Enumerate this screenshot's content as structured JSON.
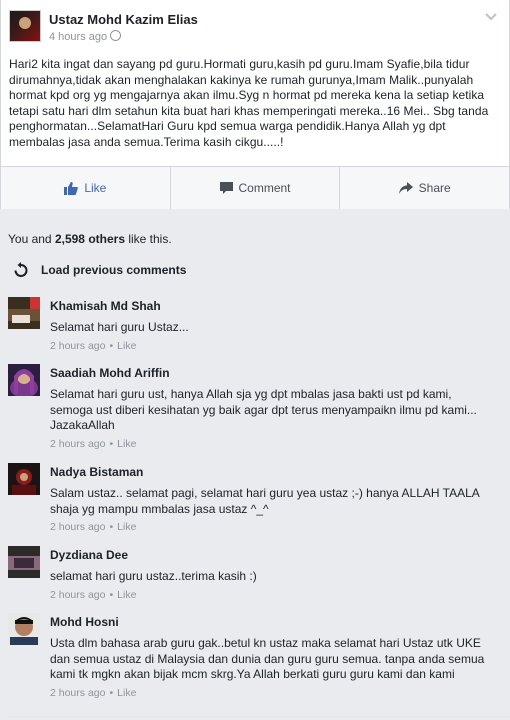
{
  "post": {
    "author": "Ustaz Mohd Kazim Elias",
    "time": "4 hours ago",
    "text": "Hari2 kita ingat dan sayang pd guru.Hormati guru,kasih pd guru.Imam Syafie,bila tidur dirumahnya,tidak akan menghalakan kakinya ke rumah gurunya,Imam Malik..punyalah hormat kpd org yg mengajarnya akan ilmu.Syg n hormat pd mereka kena la setiap ketika tetapi satu hari dlm setahun kita buat hari khas memperingati mereka..16 Mei.. Sbg tanda penghormatan...SelamatHari Guru kpd semua warga pendidik.Hanya Allah yg dpt membalas jasa anda semua.Terima kasih cikgu.....!"
  },
  "actions": {
    "like": "Like",
    "comment": "Comment",
    "share": "Share"
  },
  "likes": {
    "prefix": "You and ",
    "count": "2,598 others",
    "suffix": " like this."
  },
  "load_previous": "Load previous comments",
  "comments": [
    {
      "name": "Khamisah Md Shah",
      "text": "Selamat hari guru Ustaz...",
      "time": "2 hours ago",
      "like": "Like"
    },
    {
      "name": "Saadiah Mohd Ariffin",
      "text": "Selamat hari guru ust, hanya Allah sja yg dpt mbalas jasa bakti ust pd kami, semoga ust diberi kesihatan yg baik agar dpt terus menyampaikn ilmu pd kami... JazakaAllah",
      "time": "2 hours ago",
      "like": "Like"
    },
    {
      "name": "Nadya Bistaman",
      "text": "Salam ustaz.. selamat pagi, selamat hari guru yea ustaz ;-) hanya ALLAH TAALA shaja yg mampu mmbalas jasa ustaz ^_^",
      "time": "2 hours ago",
      "like": "Like"
    },
    {
      "name": "Dyzdiana Dee",
      "text": "selamat hari guru ustaz..terima kasih :)",
      "time": "2 hours ago",
      "like": "Like"
    },
    {
      "name": "Mohd Hosni",
      "text": "Usta dlm bahasa arab guru gak..betul kn ustaz maka selamat hari Ustaz utk UKE dan semua ustaz di Malaysia dan dunia dan guru guru semua. tanpa anda semua kami tk mgkn akan bijak mcm skrg.Ya Allah berkati guru guru kami dan kami",
      "time": "2 hours ago",
      "like": "Like"
    }
  ],
  "colors": {
    "link": "#4267b2",
    "meta": "#90949c",
    "text": "#1d2129"
  }
}
